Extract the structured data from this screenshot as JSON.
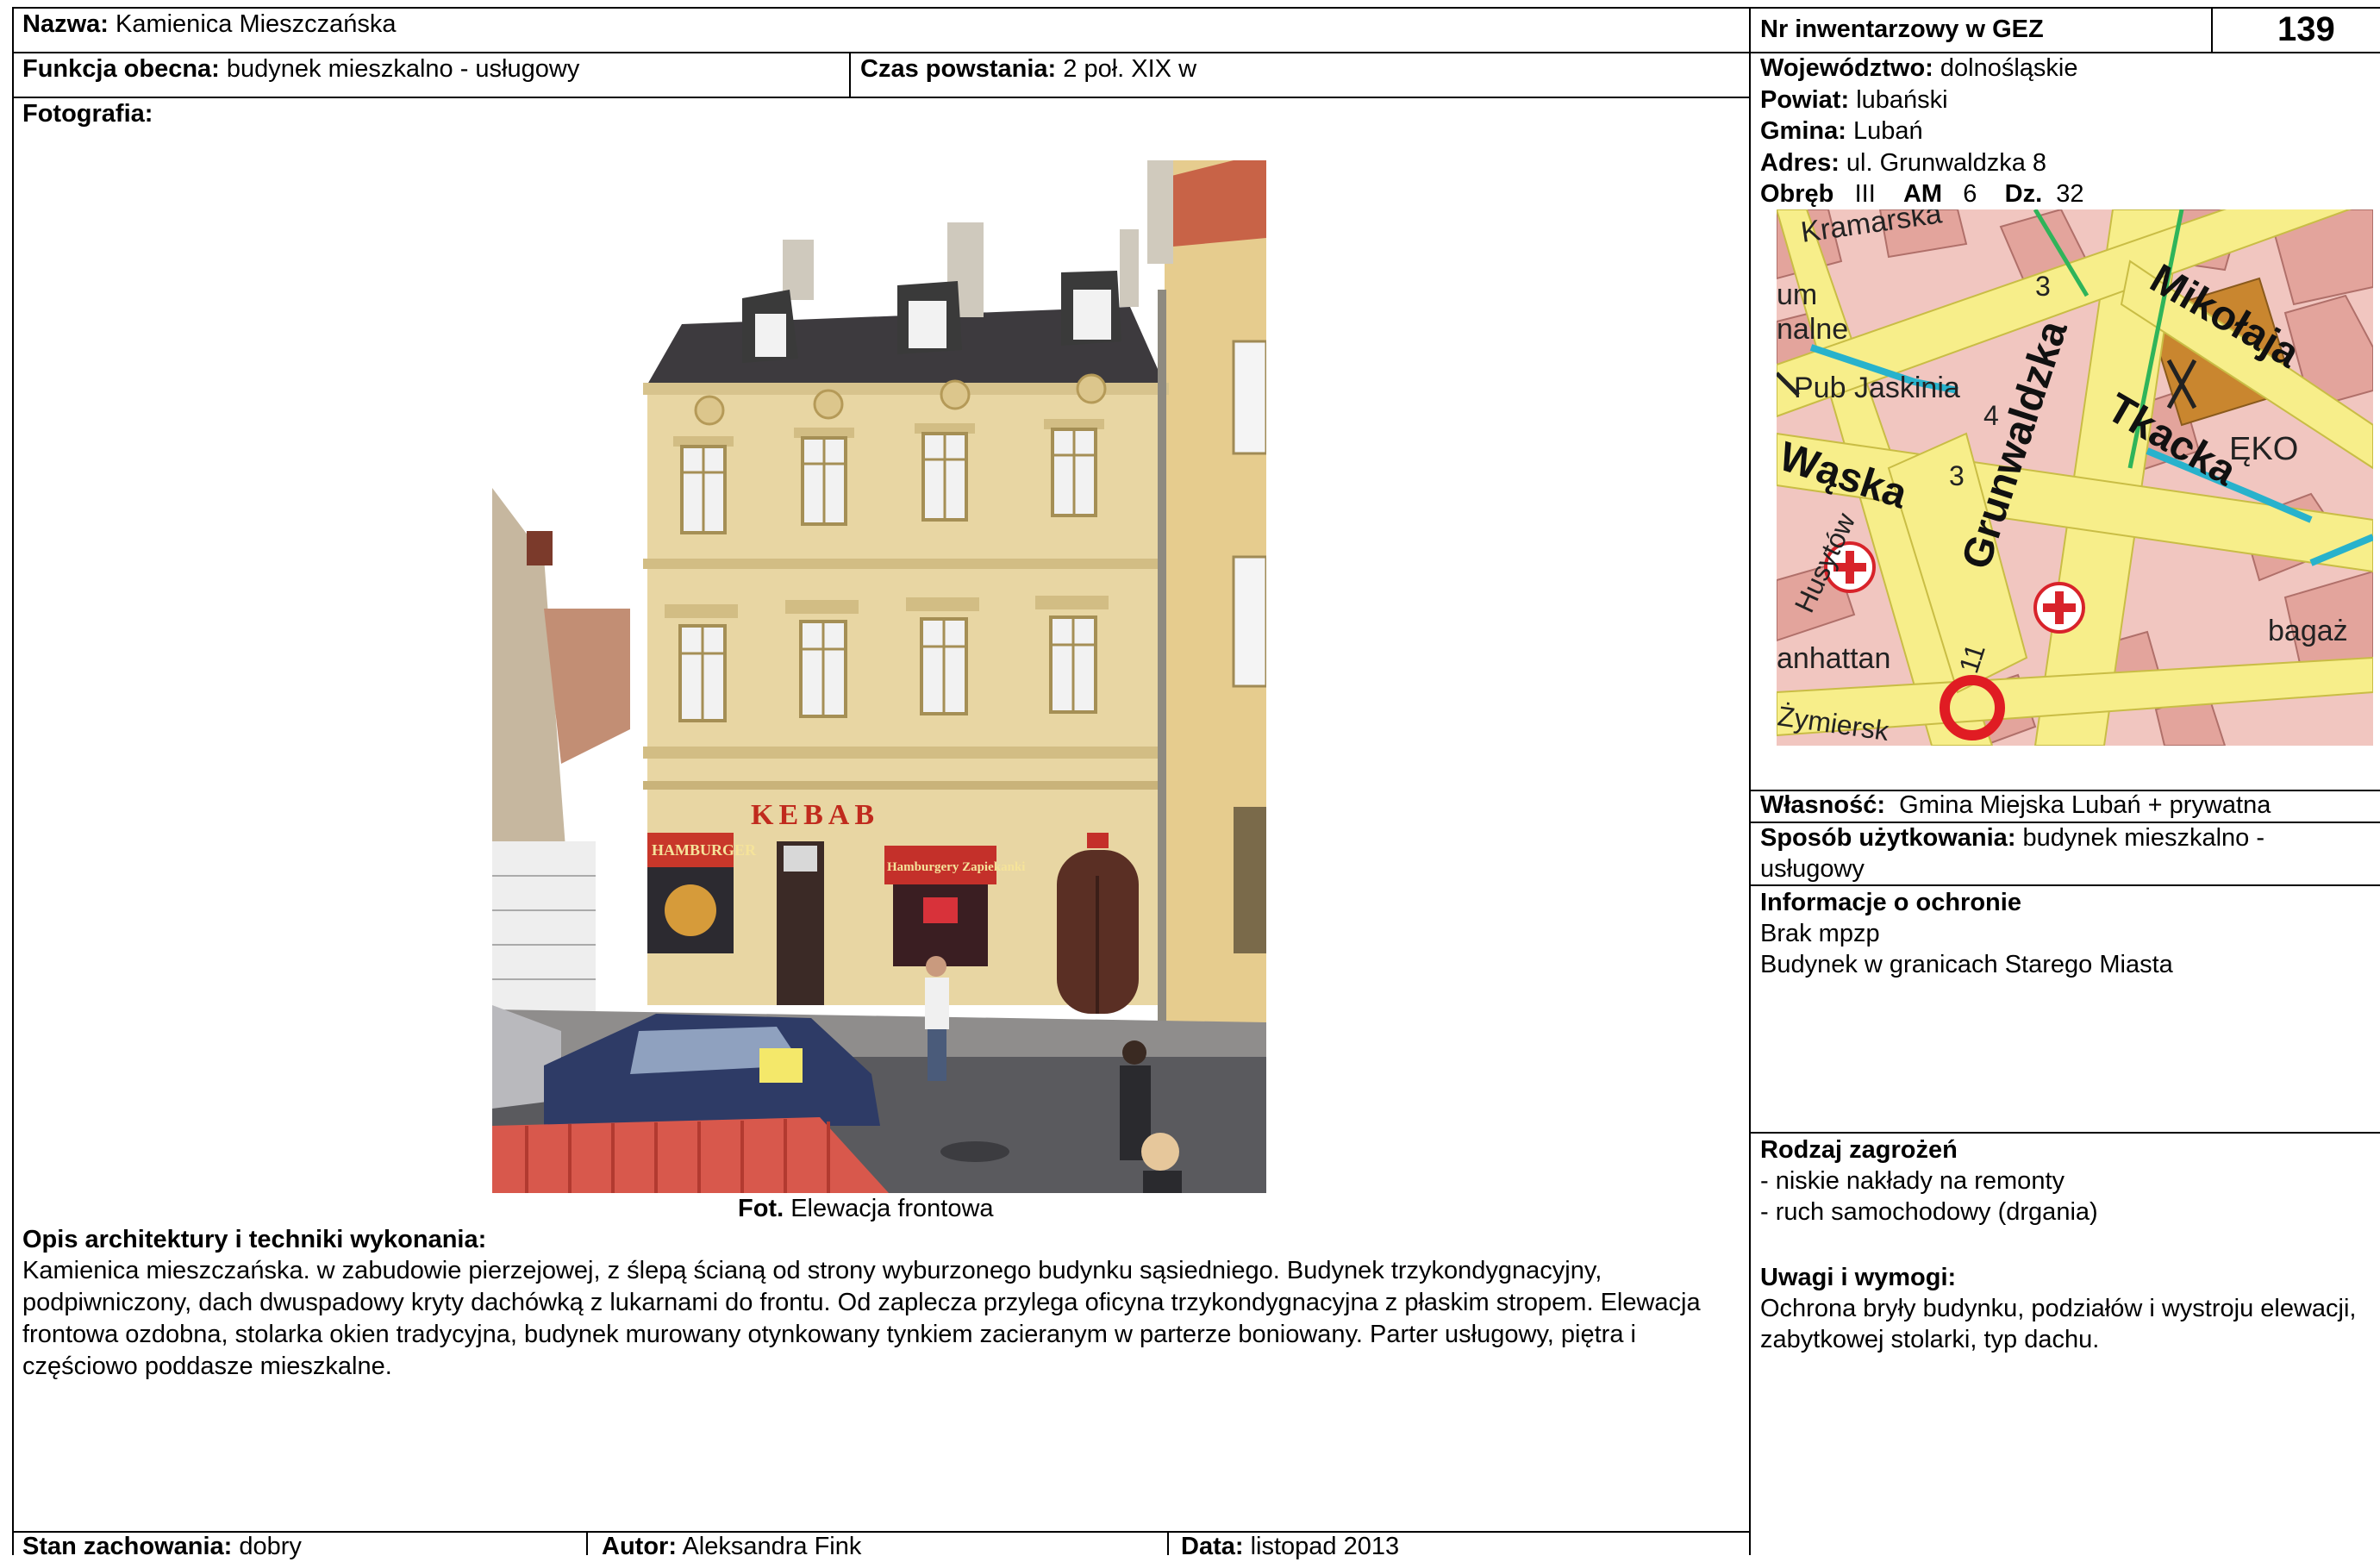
{
  "header": {
    "name_label": "Nazwa:",
    "name_value": "Kamienica Mieszczańska",
    "function_label": "Funkcja obecna:",
    "function_value": "budynek mieszkalno - usługowy",
    "time_label": "Czas powstania:",
    "time_value": "2 poł. XIX w",
    "photo_label": "Fotografia:"
  },
  "inventory": {
    "label": "Nr inwentarzowy w GEZ",
    "number": "139"
  },
  "location": {
    "voivodeship_label": "Województwo:",
    "voivodeship_value": "dolnośląskie",
    "county_label": "Powiat:",
    "county_value": "lubański",
    "commune_label": "Gmina:",
    "commune_value": "Lubań",
    "address_label": "Adres:",
    "address_value": "ul. Grunwaldzka 8",
    "precinct_label": "Obręb",
    "precinct_value": "III",
    "am_label": "AM",
    "am_value": "6",
    "dz_label": "Dz.",
    "dz_value": "32"
  },
  "map": {
    "labels": [
      "Kramarska",
      "Mikołaja",
      "Pub Jaskinia",
      "Wąska",
      "Grunwaldzka",
      "Tkacka",
      "Husytów",
      "ĘKO",
      "bagaż",
      "anhattan",
      "Żymiersk",
      "um",
      "nalne",
      "3",
      "3",
      "4",
      "11"
    ]
  },
  "photo": {
    "caption_label": "Fot.",
    "caption_value": "Elewacja frontowa",
    "sign_kebab": "KEBAB",
    "sign_hamburger": "HAMBURGER",
    "sign_shop": "Hamburgery Zapiekanki"
  },
  "description": {
    "title": "Opis architektury i techniki wykonania:",
    "text": "Kamienica mieszczańska. w zabudowie pierzejowej, z ślepą ścianą od strony wyburzonego budynku sąsiedniego. Budynek trzykondygnacyjny, podpiwniczony, dach dwuspadowy kryty dachówką z lukarnami do frontu. Od zaplecza przylega oficyna trzykondygnacyjna z płaskim stropem. Elewacja frontowa ozdobna, stolarka okien tradycyjna, budynek murowany otynkowany tynkiem zacieranym w parterze boniowany. Parter usługowy, piętra i częściowo poddasze mieszkalne."
  },
  "ownership": {
    "label": "Własność:",
    "value": "Gmina Miejska Lubań + prywatna"
  },
  "usage": {
    "label": "Sposób użytkowania:",
    "value": "budynek mieszkalno - usługowy"
  },
  "protection": {
    "title": "Informacje o ochronie",
    "line1": "Brak mpzp",
    "line2": "Budynek w granicach Starego Miasta"
  },
  "threats": {
    "title": "Rodzaj zagrożeń",
    "items": [
      "- niskie nakłady na remonty",
      "- ruch samochodowy (drgania)"
    ]
  },
  "remarks": {
    "title": "Uwagi i wymogi:",
    "text": "Ochrona bryły budynku, podziałów i wystroju elewacji, zabytkowej stolarki, typ dachu."
  },
  "footer": {
    "state_label": "Stan zachowania:",
    "state_value": "dobry",
    "author_label": "Autor:",
    "author_value": "Aleksandra Fink",
    "date_label": "Data:",
    "date_value": "listopad 2013"
  }
}
